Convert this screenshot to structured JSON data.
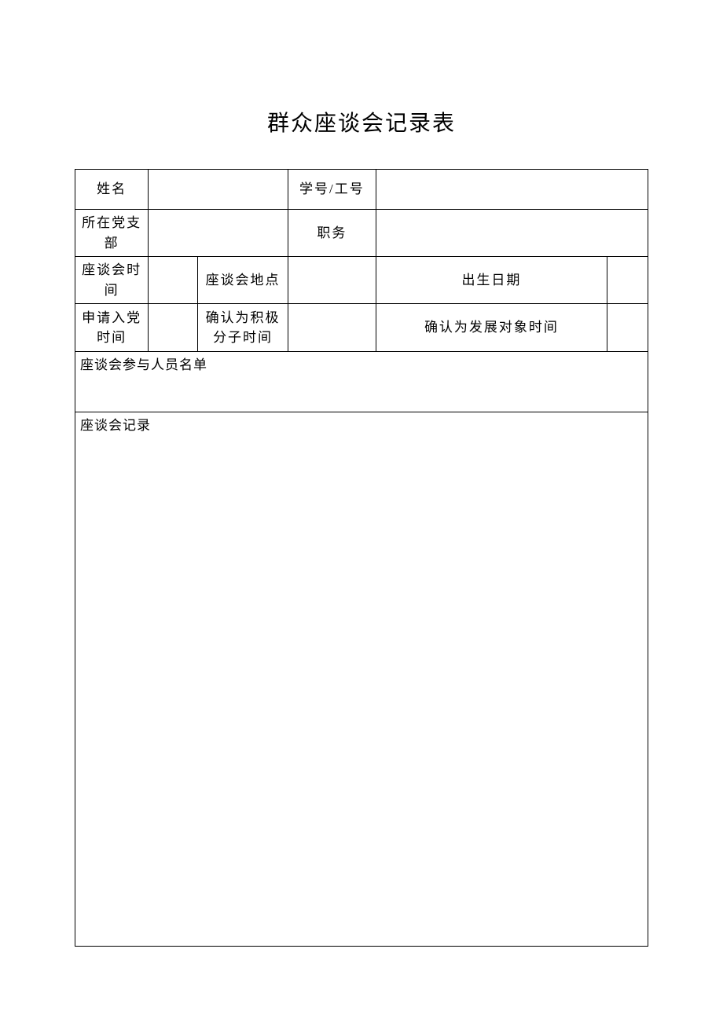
{
  "title": "群众座谈会记录表",
  "labels": {
    "name": "姓名",
    "student_id": "学号/工号",
    "branch": "所在党支部",
    "position": "职务",
    "meeting_time": "座谈会时间",
    "meeting_place": "座谈会地点",
    "birth_date": "出生日期",
    "apply_time": "申请入党时间",
    "activist_time": "确认为积极分子时间",
    "dev_target_time": "确认为发展对象时间",
    "participants": "座谈会参与人员名单",
    "minutes": "座谈会记录"
  },
  "values": {
    "name": "",
    "student_id": "",
    "branch": "",
    "position": "",
    "meeting_time": "",
    "meeting_place": "",
    "birth_date": "",
    "apply_time": "",
    "activist_time": "",
    "dev_target_time": "",
    "participants": "",
    "minutes": ""
  }
}
